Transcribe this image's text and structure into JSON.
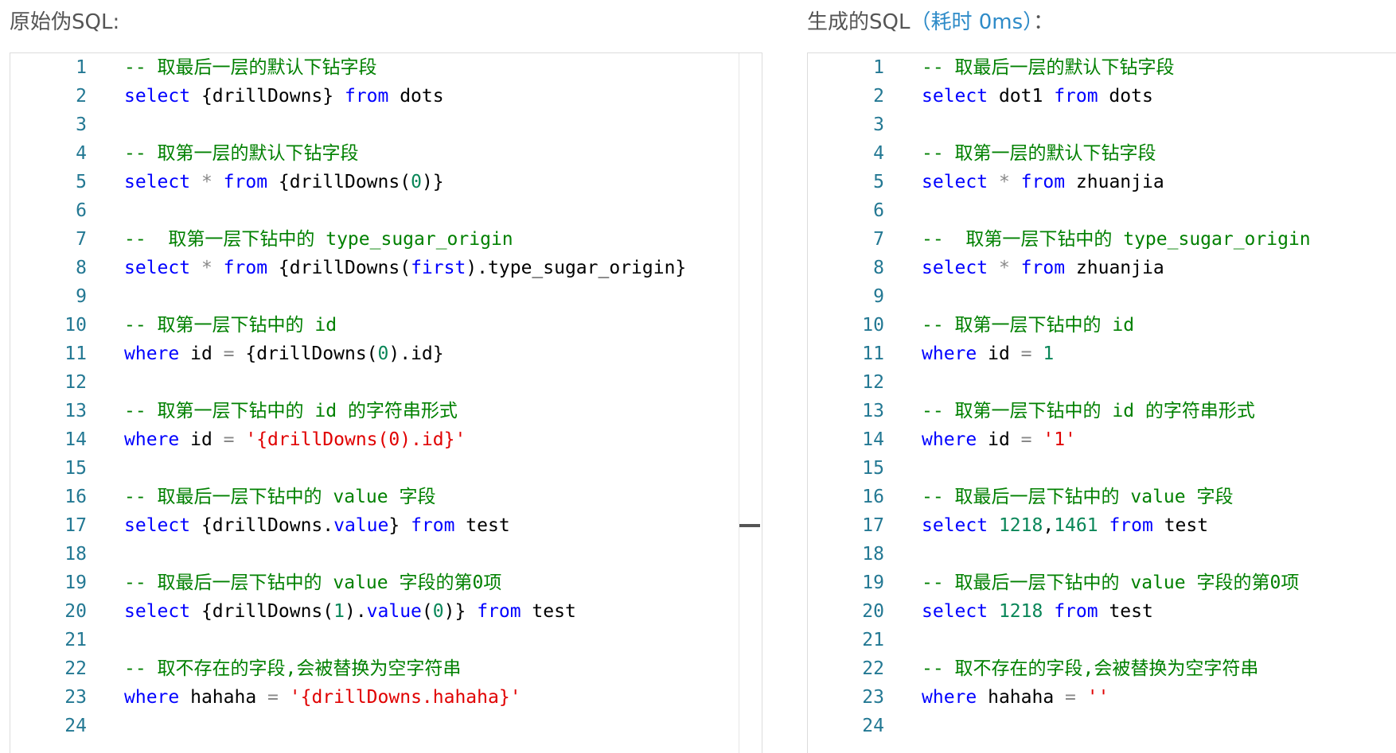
{
  "left_panel": {
    "title": "原始伪SQL:",
    "lines": [
      {
        "n": "1",
        "tokens": [
          {
            "t": "comment",
            "v": "-- 取最后一层的默认下钻字段"
          }
        ]
      },
      {
        "n": "2",
        "tokens": [
          {
            "t": "keyword",
            "v": "select"
          },
          {
            "t": "text",
            "v": " {drillDowns} "
          },
          {
            "t": "keyword",
            "v": "from"
          },
          {
            "t": "text",
            "v": " dots"
          }
        ]
      },
      {
        "n": "3",
        "tokens": []
      },
      {
        "n": "4",
        "tokens": [
          {
            "t": "comment",
            "v": "-- 取第一层的默认下钻字段"
          }
        ]
      },
      {
        "n": "5",
        "tokens": [
          {
            "t": "keyword",
            "v": "select"
          },
          {
            "t": "text",
            "v": " "
          },
          {
            "t": "operator",
            "v": "*"
          },
          {
            "t": "text",
            "v": " "
          },
          {
            "t": "keyword",
            "v": "from"
          },
          {
            "t": "text",
            "v": " {drillDowns("
          },
          {
            "t": "number",
            "v": "0"
          },
          {
            "t": "text",
            "v": ")}"
          }
        ]
      },
      {
        "n": "6",
        "tokens": []
      },
      {
        "n": "7",
        "tokens": [
          {
            "t": "comment",
            "v": "--  取第一层下钻中的 type_sugar_origin"
          }
        ]
      },
      {
        "n": "8",
        "tokens": [
          {
            "t": "keyword",
            "v": "select"
          },
          {
            "t": "text",
            "v": " "
          },
          {
            "t": "operator",
            "v": "*"
          },
          {
            "t": "text",
            "v": " "
          },
          {
            "t": "keyword",
            "v": "from"
          },
          {
            "t": "text",
            "v": " {drillDowns("
          },
          {
            "t": "keyword",
            "v": "first"
          },
          {
            "t": "text",
            "v": ").type_sugar_origin}"
          }
        ]
      },
      {
        "n": "9",
        "tokens": []
      },
      {
        "n": "10",
        "tokens": [
          {
            "t": "comment",
            "v": "-- 取第一层下钻中的 id"
          }
        ]
      },
      {
        "n": "11",
        "tokens": [
          {
            "t": "keyword",
            "v": "where"
          },
          {
            "t": "text",
            "v": " id "
          },
          {
            "t": "operator",
            "v": "="
          },
          {
            "t": "text",
            "v": " {drillDowns("
          },
          {
            "t": "number",
            "v": "0"
          },
          {
            "t": "text",
            "v": ").id}"
          }
        ]
      },
      {
        "n": "12",
        "tokens": []
      },
      {
        "n": "13",
        "tokens": [
          {
            "t": "comment",
            "v": "-- 取第一层下钻中的 id 的字符串形式"
          }
        ]
      },
      {
        "n": "14",
        "tokens": [
          {
            "t": "keyword",
            "v": "where"
          },
          {
            "t": "text",
            "v": " id "
          },
          {
            "t": "operator",
            "v": "="
          },
          {
            "t": "text",
            "v": " "
          },
          {
            "t": "string",
            "v": "'{drillDowns(0).id}'"
          }
        ]
      },
      {
        "n": "15",
        "tokens": []
      },
      {
        "n": "16",
        "tokens": [
          {
            "t": "comment",
            "v": "-- 取最后一层下钻中的 value 字段"
          }
        ]
      },
      {
        "n": "17",
        "tokens": [
          {
            "t": "keyword",
            "v": "select"
          },
          {
            "t": "text",
            "v": " {drillDowns."
          },
          {
            "t": "keyword",
            "v": "value"
          },
          {
            "t": "text",
            "v": "} "
          },
          {
            "t": "keyword",
            "v": "from"
          },
          {
            "t": "text",
            "v": " test"
          }
        ]
      },
      {
        "n": "18",
        "tokens": []
      },
      {
        "n": "19",
        "tokens": [
          {
            "t": "comment",
            "v": "-- 取最后一层下钻中的 value 字段的第0项"
          }
        ]
      },
      {
        "n": "20",
        "tokens": [
          {
            "t": "keyword",
            "v": "select"
          },
          {
            "t": "text",
            "v": " {drillDowns("
          },
          {
            "t": "number",
            "v": "1"
          },
          {
            "t": "text",
            "v": ")."
          },
          {
            "t": "keyword",
            "v": "value"
          },
          {
            "t": "text",
            "v": "("
          },
          {
            "t": "number",
            "v": "0"
          },
          {
            "t": "text",
            "v": ")} "
          },
          {
            "t": "keyword",
            "v": "from"
          },
          {
            "t": "text",
            "v": " test"
          }
        ]
      },
      {
        "n": "21",
        "tokens": []
      },
      {
        "n": "22",
        "tokens": [
          {
            "t": "comment",
            "v": "-- 取不存在的字段,会被替换为空字符串"
          }
        ]
      },
      {
        "n": "23",
        "tokens": [
          {
            "t": "keyword",
            "v": "where"
          },
          {
            "t": "text",
            "v": " hahaha "
          },
          {
            "t": "operator",
            "v": "="
          },
          {
            "t": "text",
            "v": " "
          },
          {
            "t": "string",
            "v": "'{drillDowns.hahaha}'"
          }
        ]
      },
      {
        "n": "24",
        "tokens": []
      }
    ]
  },
  "right_panel": {
    "title": "生成的SQL",
    "timing": "（耗时 0ms）",
    "title_suffix": "：",
    "lines": [
      {
        "n": "1",
        "tokens": [
          {
            "t": "comment",
            "v": "-- 取最后一层的默认下钻字段"
          }
        ]
      },
      {
        "n": "2",
        "tokens": [
          {
            "t": "keyword",
            "v": "select"
          },
          {
            "t": "text",
            "v": " dot1 "
          },
          {
            "t": "keyword",
            "v": "from"
          },
          {
            "t": "text",
            "v": " dots"
          }
        ]
      },
      {
        "n": "3",
        "tokens": []
      },
      {
        "n": "4",
        "tokens": [
          {
            "t": "comment",
            "v": "-- 取第一层的默认下钻字段"
          }
        ]
      },
      {
        "n": "5",
        "tokens": [
          {
            "t": "keyword",
            "v": "select"
          },
          {
            "t": "text",
            "v": " "
          },
          {
            "t": "operator",
            "v": "*"
          },
          {
            "t": "text",
            "v": " "
          },
          {
            "t": "keyword",
            "v": "from"
          },
          {
            "t": "text",
            "v": " zhuanjia"
          }
        ]
      },
      {
        "n": "6",
        "tokens": []
      },
      {
        "n": "7",
        "tokens": [
          {
            "t": "comment",
            "v": "--  取第一层下钻中的 type_sugar_origin"
          }
        ]
      },
      {
        "n": "8",
        "tokens": [
          {
            "t": "keyword",
            "v": "select"
          },
          {
            "t": "text",
            "v": " "
          },
          {
            "t": "operator",
            "v": "*"
          },
          {
            "t": "text",
            "v": " "
          },
          {
            "t": "keyword",
            "v": "from"
          },
          {
            "t": "text",
            "v": " zhuanjia"
          }
        ]
      },
      {
        "n": "9",
        "tokens": []
      },
      {
        "n": "10",
        "tokens": [
          {
            "t": "comment",
            "v": "-- 取第一层下钻中的 id"
          }
        ]
      },
      {
        "n": "11",
        "tokens": [
          {
            "t": "keyword",
            "v": "where"
          },
          {
            "t": "text",
            "v": " id "
          },
          {
            "t": "operator",
            "v": "="
          },
          {
            "t": "text",
            "v": " "
          },
          {
            "t": "number",
            "v": "1"
          }
        ]
      },
      {
        "n": "12",
        "tokens": []
      },
      {
        "n": "13",
        "tokens": [
          {
            "t": "comment",
            "v": "-- 取第一层下钻中的 id 的字符串形式"
          }
        ]
      },
      {
        "n": "14",
        "tokens": [
          {
            "t": "keyword",
            "v": "where"
          },
          {
            "t": "text",
            "v": " id "
          },
          {
            "t": "operator",
            "v": "="
          },
          {
            "t": "text",
            "v": " "
          },
          {
            "t": "string",
            "v": "'1'"
          }
        ]
      },
      {
        "n": "15",
        "tokens": []
      },
      {
        "n": "16",
        "tokens": [
          {
            "t": "comment",
            "v": "-- 取最后一层下钻中的 value 字段"
          }
        ]
      },
      {
        "n": "17",
        "tokens": [
          {
            "t": "keyword",
            "v": "select"
          },
          {
            "t": "text",
            "v": " "
          },
          {
            "t": "number",
            "v": "1218"
          },
          {
            "t": "text",
            "v": ","
          },
          {
            "t": "number",
            "v": "1461"
          },
          {
            "t": "text",
            "v": " "
          },
          {
            "t": "keyword",
            "v": "from"
          },
          {
            "t": "text",
            "v": " test"
          }
        ]
      },
      {
        "n": "18",
        "tokens": []
      },
      {
        "n": "19",
        "tokens": [
          {
            "t": "comment",
            "v": "-- 取最后一层下钻中的 value 字段的第0项"
          }
        ]
      },
      {
        "n": "20",
        "tokens": [
          {
            "t": "keyword",
            "v": "select"
          },
          {
            "t": "text",
            "v": " "
          },
          {
            "t": "number",
            "v": "1218"
          },
          {
            "t": "text",
            "v": " "
          },
          {
            "t": "keyword",
            "v": "from"
          },
          {
            "t": "text",
            "v": " test"
          }
        ]
      },
      {
        "n": "21",
        "tokens": []
      },
      {
        "n": "22",
        "tokens": [
          {
            "t": "comment",
            "v": "-- 取不存在的字段,会被替换为空字符串"
          }
        ]
      },
      {
        "n": "23",
        "tokens": [
          {
            "t": "keyword",
            "v": "where"
          },
          {
            "t": "text",
            "v": " hahaha "
          },
          {
            "t": "operator",
            "v": "="
          },
          {
            "t": "text",
            "v": " "
          },
          {
            "t": "string",
            "v": "''"
          }
        ]
      },
      {
        "n": "24",
        "tokens": []
      }
    ]
  },
  "colors": {
    "comment": "#008000",
    "keyword": "#0000ff",
    "number": "#098658",
    "string": "#e00000",
    "operator": "#888888",
    "line_number": "#237893",
    "title": "#555555",
    "timing": "#2e8bc8"
  }
}
